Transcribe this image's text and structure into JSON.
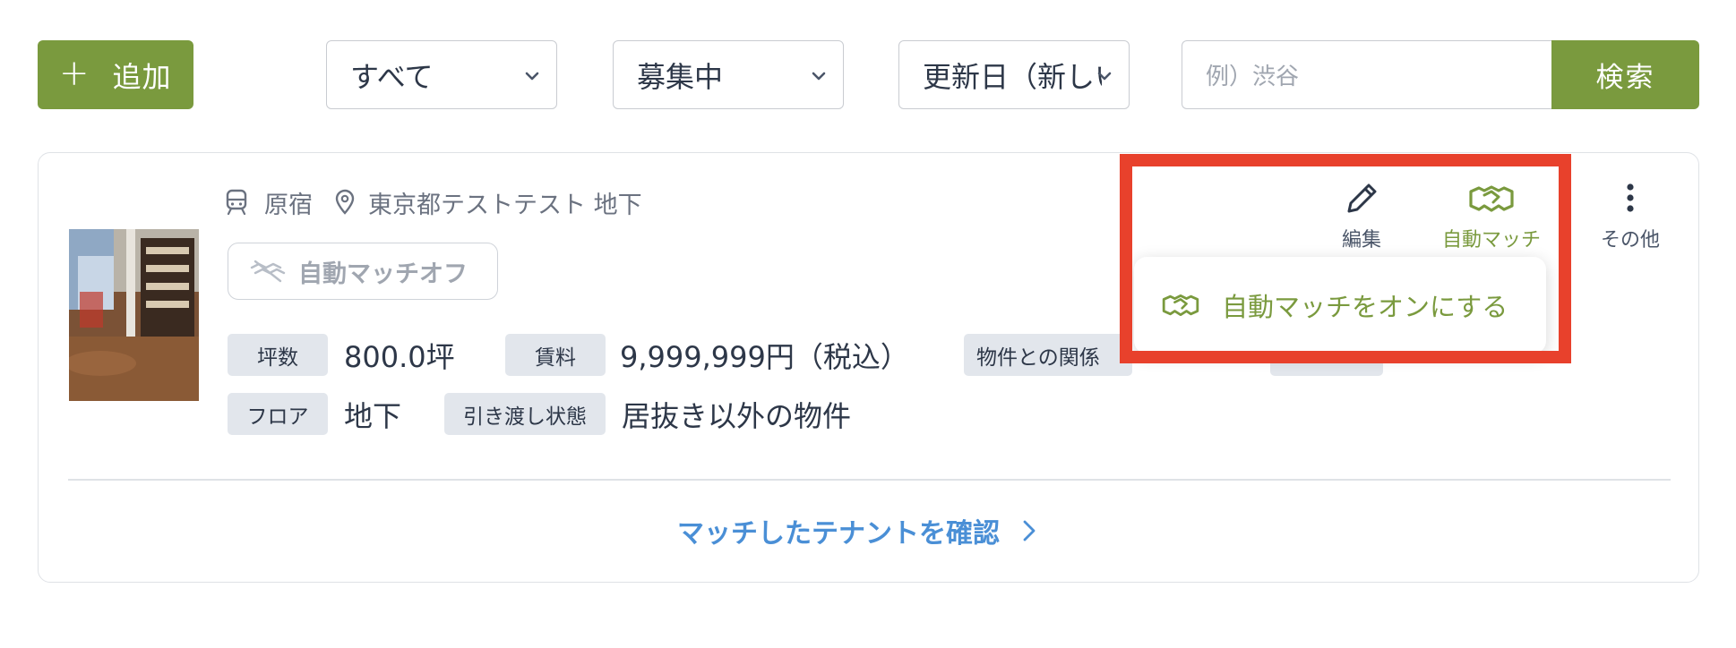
{
  "toolbar": {
    "add_label": "追加",
    "filters": [
      "すべて",
      "募集中",
      "更新日（新しい順）"
    ],
    "search_placeholder": "例）渋谷",
    "search_label": "検索"
  },
  "card": {
    "station": "原宿",
    "address": "東京都テストテスト 地下",
    "automatch_status": "自動マッチオフ",
    "specs_row1": [
      {
        "tag": "坪数",
        "value": "800.0坪"
      },
      {
        "tag": "賃料",
        "value": "9,999,999円（税込）"
      },
      {
        "tag": "物件との関係",
        "value": ""
      }
    ],
    "specs_row2": [
      {
        "tag": "フロア",
        "value": "地下"
      },
      {
        "tag": "引き渡し状態",
        "value": "居抜き以外の物件"
      }
    ],
    "tenant_link": "マッチしたテナントを確認"
  },
  "actions": {
    "edit": "編集",
    "automatch": "自動マッチ",
    "more": "その他"
  },
  "popup": {
    "item": "自動マッチをオンにする"
  },
  "colors": {
    "brand_green": "#7a9a3e",
    "link_blue": "#4a8fd6",
    "highlight_red": "#e8412c"
  }
}
